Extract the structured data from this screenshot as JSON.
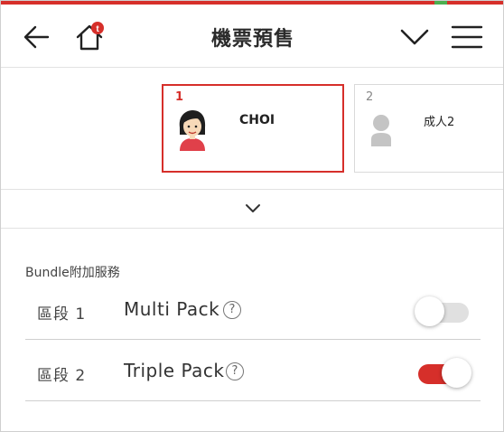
{
  "header": {
    "title": "機票預售",
    "back_icon": "arrow-left-icon",
    "home_icon": "home-icon",
    "home_badge": "t",
    "dropdown_icon": "chevron-down-icon",
    "menu_icon": "hamburger-menu-icon"
  },
  "passengers": [
    {
      "number": "1",
      "name": "CHOI",
      "selected": true,
      "avatar": "female-avatar-icon"
    },
    {
      "number": "2",
      "name": "成人2",
      "selected": false,
      "avatar": "person-placeholder-icon"
    }
  ],
  "expand_icon": "chevron-down-icon",
  "bundle": {
    "title": "Bundle附加服務",
    "rows": [
      {
        "segment": "區段 1",
        "service": "Multi Pack",
        "help": "?",
        "enabled": false
      },
      {
        "segment": "區段 2",
        "service": "Triple Pack",
        "help": "?",
        "enabled": true
      }
    ]
  },
  "colors": {
    "accent": "#d62f2a",
    "toggle_off": "#e0e0e0"
  }
}
